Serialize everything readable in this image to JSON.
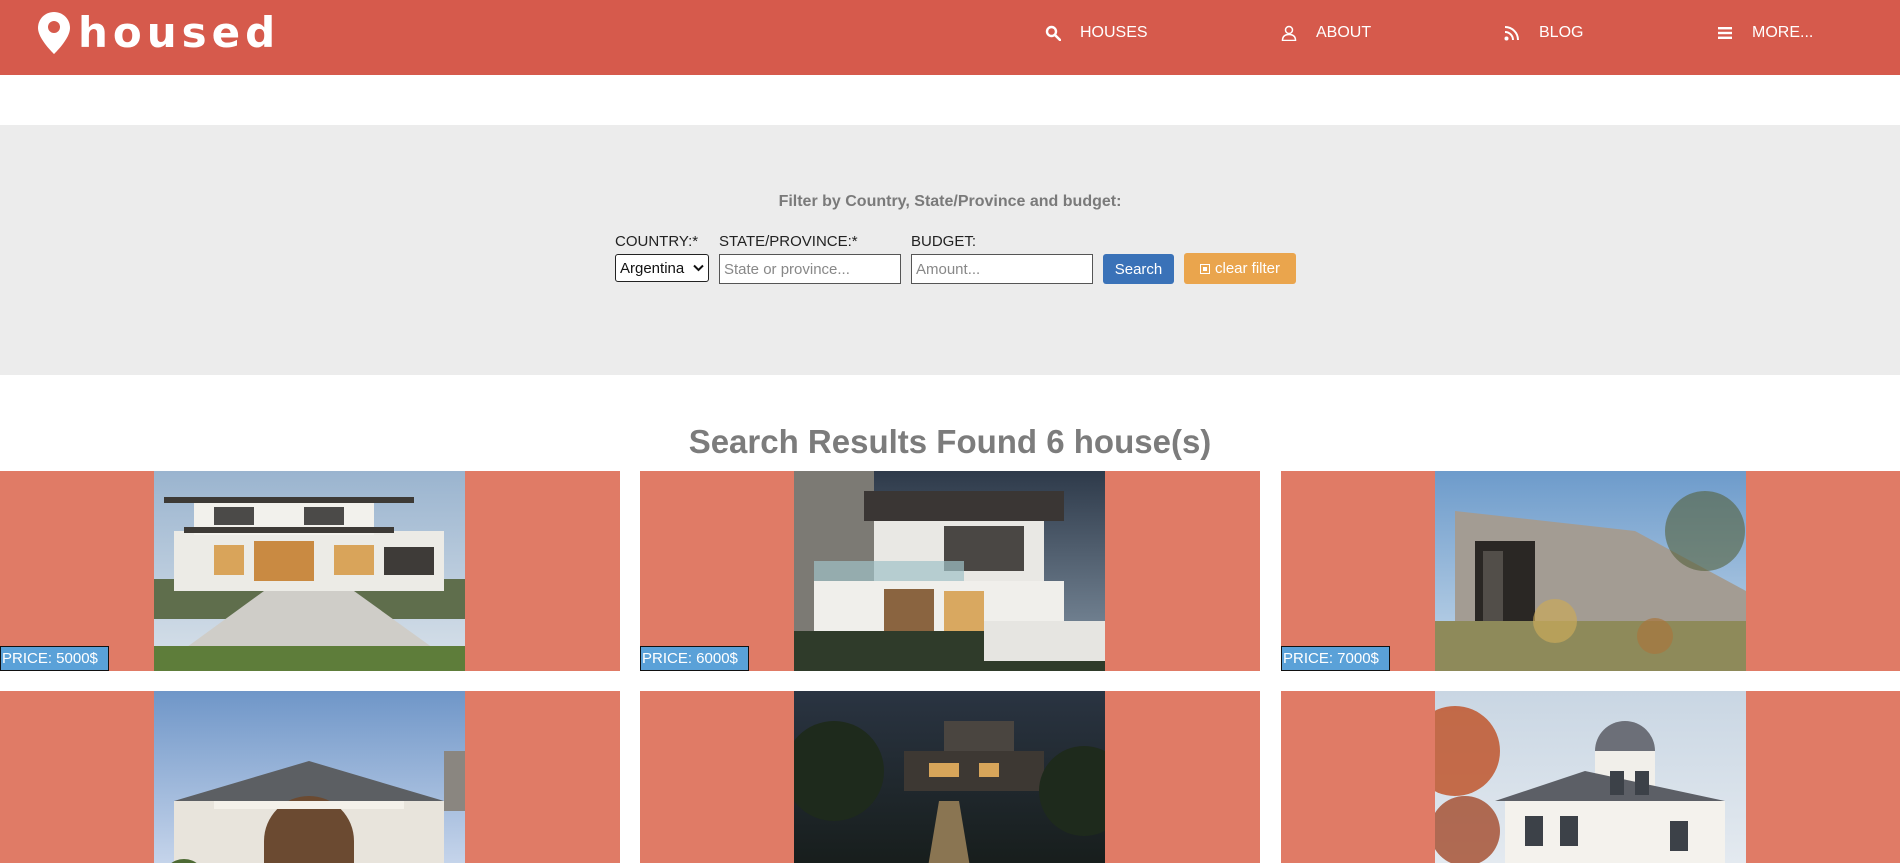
{
  "brand": {
    "name": "housed"
  },
  "nav": {
    "items": [
      {
        "label": "HOUSES",
        "icon": "search-icon"
      },
      {
        "label": "ABOUT",
        "icon": "user-icon"
      },
      {
        "label": "BLOG",
        "icon": "rss-icon"
      },
      {
        "label": "MORE...",
        "icon": "menu-icon"
      }
    ]
  },
  "filter": {
    "title": "Filter by Country, State/Province and budget:",
    "country": {
      "label": "COUNTRY:*",
      "value": "Argentina"
    },
    "state": {
      "label": "STATE/PROVINCE:*",
      "placeholder": "State or province..."
    },
    "budget": {
      "label": "BUDGET:",
      "placeholder": "Amount..."
    },
    "search_label": "Search",
    "clear_label": "clear filter"
  },
  "results": {
    "heading": "Search Results Found 6 house(s)",
    "houses": [
      {
        "price": "PRICE: 5000$"
      },
      {
        "price": "PRICE: 6000$"
      },
      {
        "price": "PRICE: 7000$"
      },
      {
        "price": ""
      },
      {
        "price": ""
      },
      {
        "price": ""
      }
    ]
  },
  "colors": {
    "navbar": "#d65a4c",
    "card": "#e07b66",
    "filter_bg": "#ececec",
    "search_button": "#3a72b8",
    "clear_button": "#eaa54d",
    "price_badge": "#5aa1d8"
  }
}
